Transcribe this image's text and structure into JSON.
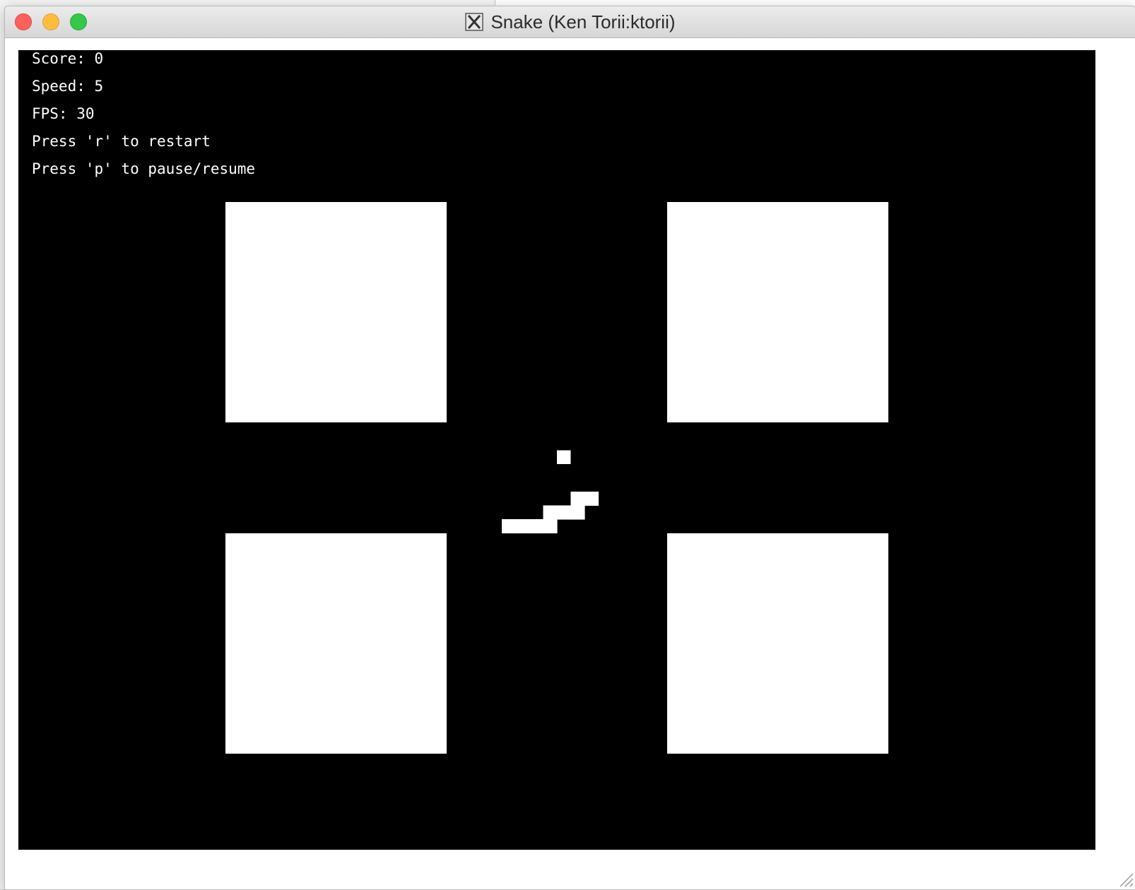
{
  "window": {
    "title": "Snake (Ken Torii:ktorii)",
    "app_icon": "x11-icon"
  },
  "controls": {
    "close": "close-button",
    "minimize": "minimize-button",
    "maximize": "zoom-button"
  },
  "hud": {
    "score": "Score: 0",
    "speed": "Speed: 5",
    "fps": "FPS: 30",
    "restart_hint": "Press 'r' to restart",
    "pause_hint": "Press 'p' to pause/resume"
  },
  "game": {
    "score": 0,
    "speed": 5,
    "fps": 30,
    "background_color": "#000000",
    "foreground_color": "#ffffff",
    "snake_cells": [
      [
        0,
        0
      ],
      [
        1,
        0
      ],
      [
        2,
        0
      ],
      [
        3,
        0
      ],
      [
        3,
        -1
      ],
      [
        4,
        -1
      ],
      [
        5,
        -1
      ],
      [
        5,
        -2
      ],
      [
        6,
        -2
      ]
    ],
    "food_cell": [
      4,
      -5
    ]
  }
}
